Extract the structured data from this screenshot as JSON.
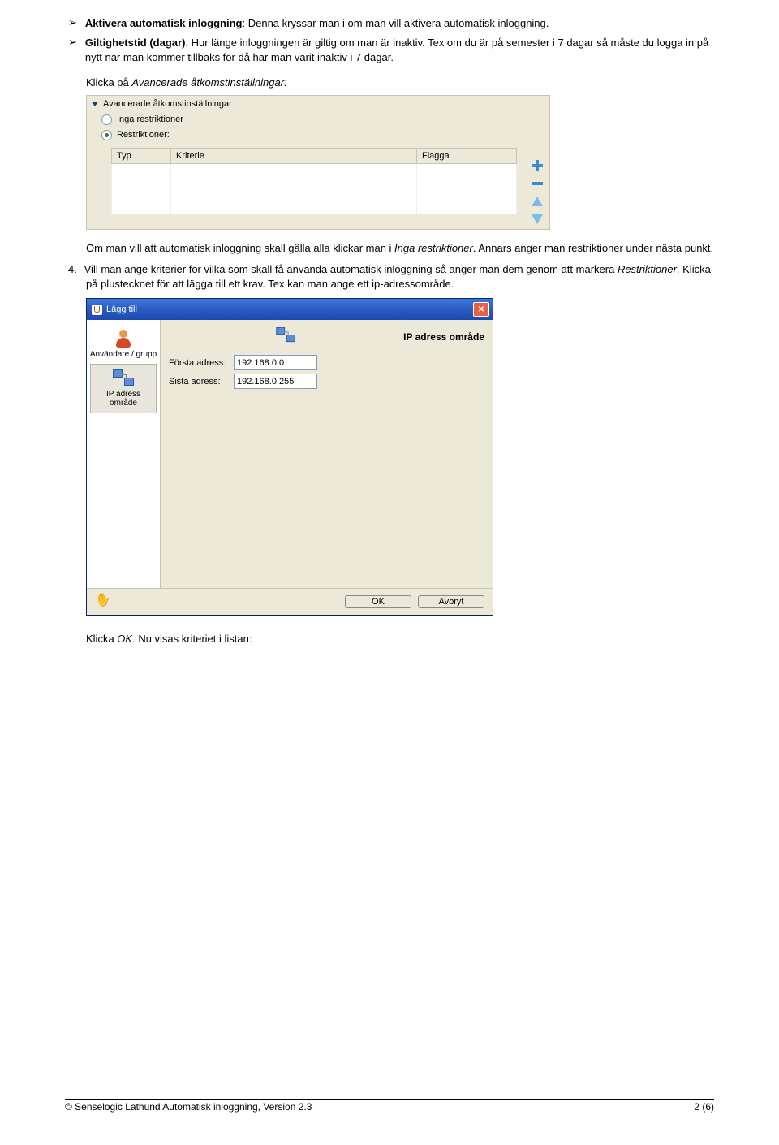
{
  "bullets": [
    {
      "bold": "Aktivera automatisk inloggning",
      "rest": ": Denna kryssar man i om man vill aktivera automatisk inloggning."
    },
    {
      "bold": "Giltighetstid (dagar)",
      "rest": ": Hur länge inloggningen är giltig om man är inaktiv. Tex om du är på semester i 7 dagar så måste du logga in på nytt när man kommer tillbaks för då har man varit inaktiv i 7 dagar."
    }
  ],
  "pre_panel_text": "Klicka på ",
  "pre_panel_italic": "Avancerade åtkomstinställningar:",
  "panel1": {
    "section": "Avancerade åtkomstinställningar",
    "radio_none": "Inga restriktioner",
    "radio_restr": "Restriktioner:",
    "col_typ": "Typ",
    "col_kriterie": "Kriterie",
    "col_flagga": "Flagga"
  },
  "para_after_panel_a": "Om man vill att automatisk inloggning skall gälla alla klickar man i ",
  "para_after_panel_italic1": "Inga restriktioner",
  "para_after_panel_b": ". Annars anger man restriktioner under nästa punkt.",
  "item4_a": "Vill man ange kriterier för vilka som skall få använda automatisk inloggning så anger man dem genom att markera ",
  "item4_italic1": "Restriktioner",
  "item4_b": ". Klicka på plustecknet för att lägga till ett krav. Tex kan man ange ett ip-adressområde.",
  "item4_num": "4.",
  "dialog": {
    "title": "Lägg till",
    "left_user": "Användare / grupp",
    "left_ip": "IP adress område",
    "header": "IP adress område",
    "first_label": "Första adress:",
    "last_label": "Sista adress:",
    "first_value": "192.168.0.0",
    "last_value": "192.168.0.255",
    "ok": "OK",
    "cancel": "Avbryt"
  },
  "after_dialog_a": "Klicka ",
  "after_dialog_italic": "OK",
  "after_dialog_b": ". Nu visas kriteriet i listan:",
  "footer_left": "© Senselogic Lathund Automatisk inloggning, Version 2.3",
  "footer_right": "2 (6)"
}
